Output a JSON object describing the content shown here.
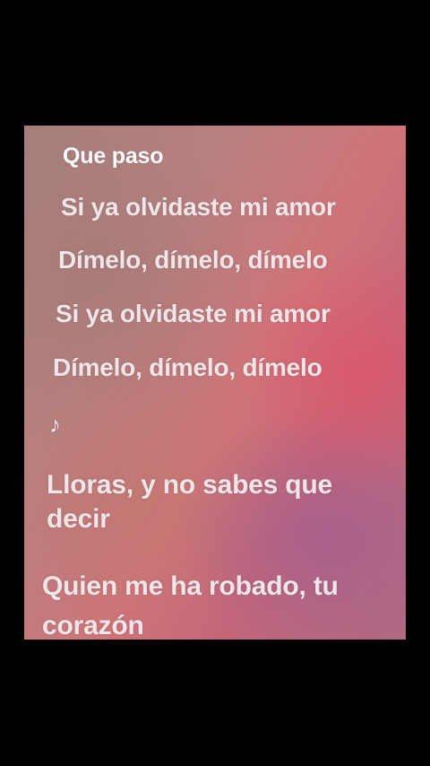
{
  "lyrics": {
    "current_line": "Que paso",
    "lines": [
      "Si ya olvidaste mi amor",
      "Dímelo, dímelo, dímelo",
      "Si ya olvidaste mi amor",
      "Dímelo, dímelo, dímelo",
      "♪",
      "Lloras, y no sabes que decir",
      "Quien me ha robado, tu corazón"
    ]
  },
  "colors": {
    "background": "#000000",
    "text": "#efe6e9",
    "current_text": "#ffffff",
    "accent_pink": "#cf7478"
  },
  "icons": {
    "music_note": "music-note-icon"
  }
}
